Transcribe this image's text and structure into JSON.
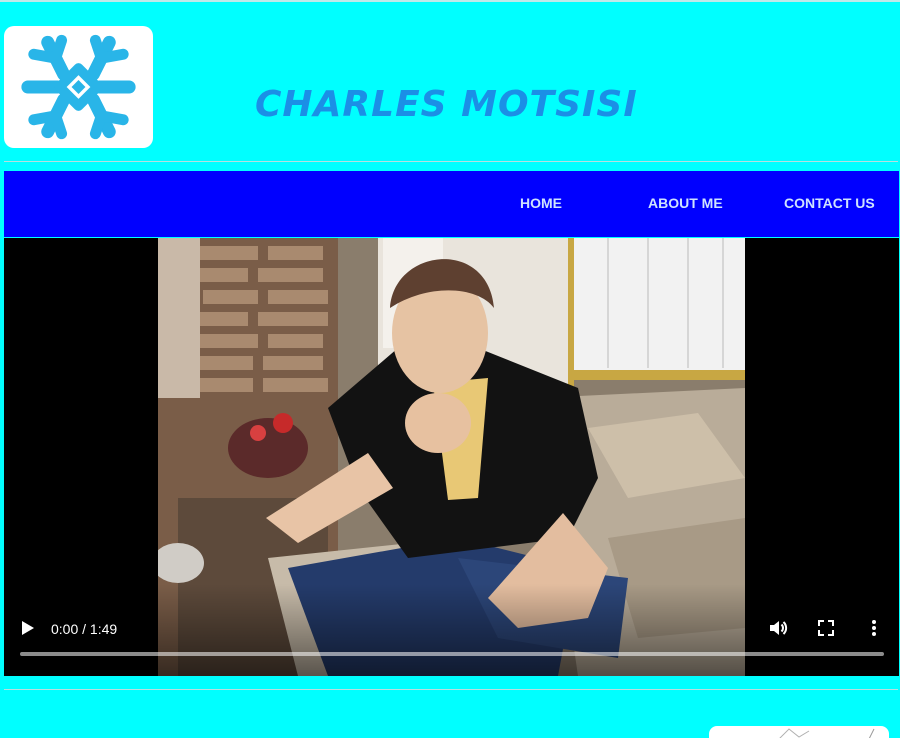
{
  "header": {
    "site_title": "CHARLES MOTSISI",
    "logo_icon": "snowflake-icon",
    "logo_color": "#29b5e8"
  },
  "nav": {
    "items": [
      {
        "label": "HOME"
      },
      {
        "label": "ABOUT ME"
      },
      {
        "label": "CONTACT US"
      }
    ]
  },
  "video": {
    "time": "0:00 / 1:49",
    "progress": 0,
    "controls": [
      "play-icon",
      "volume-icon",
      "fullscreen-icon",
      "more-options-icon"
    ]
  },
  "colors": {
    "page_background": "#00ffff",
    "navbar_background": "#0000ff",
    "nav_text": "#cfe3ff",
    "title_text": "#1b8fe6"
  }
}
